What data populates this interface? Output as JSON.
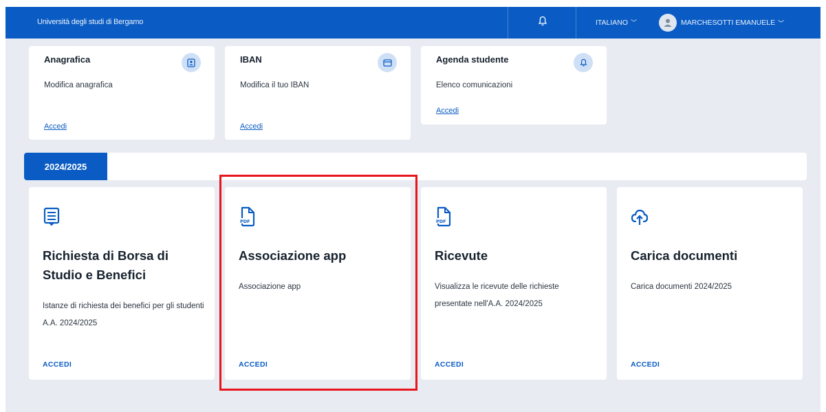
{
  "header": {
    "brand": "Università degli studi di Bergamo",
    "notifications_icon": "bell-icon",
    "language": "ITALIANO",
    "user_name": "MARCHESOTTI EMANUELE",
    "background_color": "#0a5cc4"
  },
  "quick_cards": [
    {
      "title": "Anagrafica",
      "description": "Modifica anagrafica",
      "link": "Accedi",
      "icon": "id-card-icon"
    },
    {
      "title": "IBAN",
      "description": "Modifica il tuo IBAN",
      "link": "Accedi",
      "icon": "credit-card-icon"
    },
    {
      "title": "Agenda studente",
      "description": "Elenco comunicazioni",
      "link": "Accedi",
      "icon": "bell-icon"
    }
  ],
  "year_tabs": [
    {
      "label": "2024/2025",
      "active": true
    }
  ],
  "service_cards": [
    {
      "title": "Richiesta di Borsa di Studio e Benefici",
      "description": "Istanze di richiesta dei benefici per gli studenti A.A. 2024/2025",
      "action": "ACCEDI",
      "icon": "form-icon"
    },
    {
      "title": "Associazione app",
      "description": "Associazione app",
      "action": "ACCEDI",
      "icon": "pdf-icon",
      "highlighted": true
    },
    {
      "title": "Ricevute",
      "description": "Visualizza le ricevute delle richieste presentate nell'A.A. 2024/2025",
      "action": "ACCEDI",
      "icon": "pdf-icon"
    },
    {
      "title": "Carica documenti",
      "description": "Carica documenti 2024/2025",
      "action": "ACCEDI",
      "icon": "cloud-upload-icon"
    }
  ],
  "colors": {
    "accent": "#0a5cc4",
    "page_background": "#e8ecf2",
    "highlight": "#e8141b"
  }
}
